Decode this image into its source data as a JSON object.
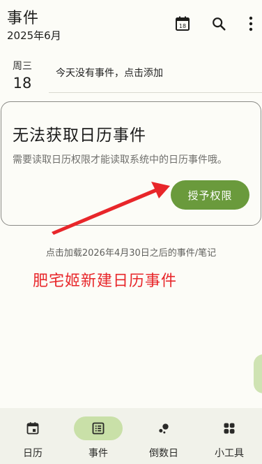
{
  "header": {
    "title": "事件",
    "subtitle": "2025年6月",
    "calendar_icon_day": "18"
  },
  "day": {
    "weekday": "周三",
    "number": "18",
    "empty_text": "今天没有事件，点击添加"
  },
  "permission_card": {
    "title": "无法获取日历事件",
    "description": "需要读取日历权限才能读取系统中的日历事件哦。",
    "button_label": "授予权限"
  },
  "load_more_text": "点击加载2026年4月30日之后的事件/笔记",
  "annotation_text": "肥宅姬新建日历事件",
  "bottom_nav": {
    "items": [
      {
        "label": "日历",
        "icon": "calendar-icon"
      },
      {
        "label": "事件",
        "icon": "list-icon"
      },
      {
        "label": "倒数日",
        "icon": "countdown-icon"
      },
      {
        "label": "小工具",
        "icon": "widgets-icon"
      }
    ],
    "active": "事件"
  },
  "colors": {
    "accent": "#6a9a3c",
    "annotation": "#e8262a",
    "active_pill": "#c9e0a8"
  }
}
